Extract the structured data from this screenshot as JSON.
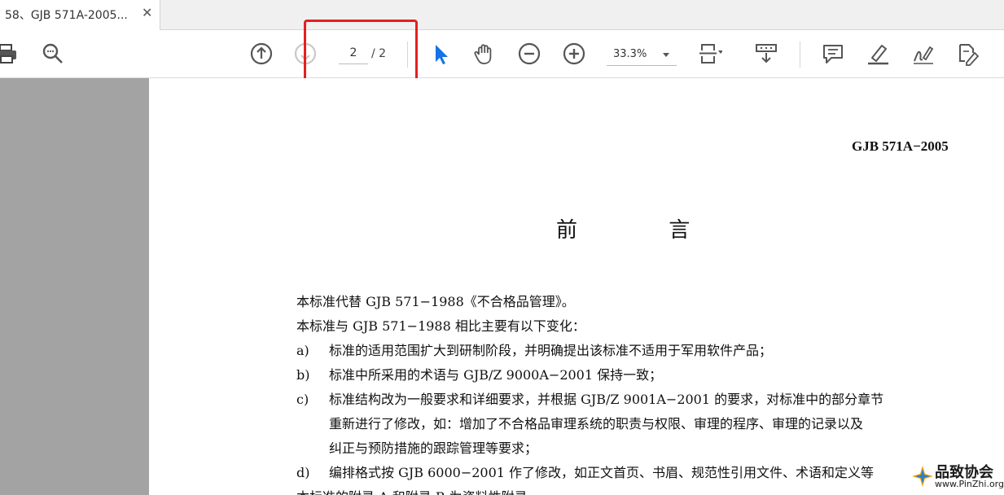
{
  "tab": {
    "title": "58、GJB 571A-2005...",
    "close": "✕"
  },
  "toolbar": {
    "icons": [
      "print-icon",
      "zoom-search-icon",
      "page-up-icon",
      "page-down-icon",
      "select-cursor-icon",
      "hand-tool-icon",
      "zoom-out-icon",
      "zoom-in-icon",
      "fit-page-icon",
      "scroll-mode-icon",
      "comment-icon",
      "highlight-pen-icon",
      "sign-icon",
      "edit-pdf-icon"
    ],
    "page_current": "2",
    "page_total": "/ 2",
    "zoom": "33.3%",
    "accent": "#1473e6",
    "highlight_color": "#e41f1f"
  },
  "document": {
    "code": "GJB 571A−2005",
    "title": "前  言",
    "lines": [
      "本标准代替 GJB 571−1988《不合格品管理》。",
      "本标准与 GJB 571−1988 相比主要有以下变化："
    ],
    "items": [
      {
        "mark": "a)",
        "text": "标准的适用范围扩大到研制阶段，并明确提出该标准不适用于军用软件产品；"
      },
      {
        "mark": "b)",
        "text": "标准中所采用的术语与 GJB/Z 9000A−2001 保持一致；"
      },
      {
        "mark": "c)",
        "text": "标准结构改为一般要求和详细要求，并根据 GJB/Z 9001A−2001 的要求，对标准中的部分章节"
      },
      {
        "mark": "",
        "text": "重新进行了修改，如：增加了不合格品审理系统的职责与权限、审理的程序、审理的记录以及"
      },
      {
        "mark": "",
        "text": "纠正与预防措施的跟踪管理等要求；"
      },
      {
        "mark": "d)",
        "text": "编排格式按 GJB 6000−2001 作了修改，如正文首页、书眉、规范性引用文件、术语和定义等"
      }
    ],
    "last_line": "本标准的附录 A 和附录 B 为资料性附录。"
  },
  "watermark": {
    "main": "品致协会",
    "sub": "www.PinZhi.org"
  }
}
